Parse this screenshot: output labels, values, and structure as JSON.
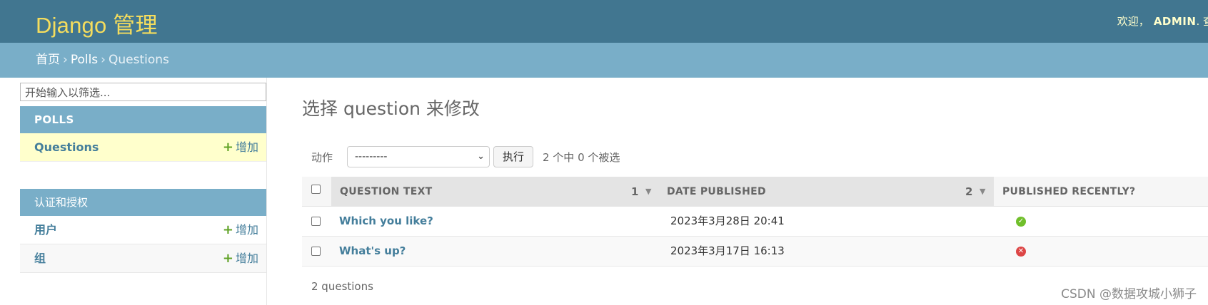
{
  "header": {
    "site_name": "Django 管理",
    "welcome": "欢迎，",
    "username": "ADMIN",
    "truncated_link": "查"
  },
  "breadcrumbs": {
    "home": "首页",
    "app": "Polls",
    "current": "Questions",
    "separator": "›"
  },
  "sidebar": {
    "filter_placeholder": "开始输入以筛选...",
    "modules": [
      {
        "caption": "POLLS",
        "models": [
          {
            "name": "Questions",
            "add_label": "增加"
          }
        ]
      },
      {
        "caption": "认证和授权",
        "models": [
          {
            "name": "用户",
            "add_label": "增加"
          },
          {
            "name": "组",
            "add_label": "增加"
          }
        ]
      }
    ]
  },
  "main": {
    "title": "选择 question 来修改",
    "actions": {
      "label": "动作",
      "selected_option": "---------",
      "go_label": "执行",
      "counter": "2 个中 0 个被选"
    },
    "table": {
      "columns": [
        {
          "label": "QUESTION TEXT",
          "sort_priority": "1"
        },
        {
          "label": "DATE PUBLISHED",
          "sort_priority": "2"
        },
        {
          "label": "PUBLISHED RECENTLY?",
          "sort_priority": ""
        }
      ],
      "rows": [
        {
          "question_text": "Which you like?",
          "date_published": "2023年3月28日 20:41",
          "published_recently": true,
          "status_icon": "yes-icon"
        },
        {
          "question_text": "What's up?",
          "date_published": "2023年3月17日 16:13",
          "published_recently": false,
          "status_icon": "no-icon"
        }
      ]
    },
    "paginator": "2 questions"
  },
  "watermark": "CSDN @数据攻城小狮子",
  "colors": {
    "header_bg": "#417690",
    "site_name": "#f5dd5d",
    "breadcrumb_bg": "#79aec8",
    "link": "#447e9b",
    "add_plus": "#5fa225",
    "selected_row_bg": "#ffffcc",
    "status_yes": "#70bf2b",
    "status_no": "#dd4646"
  }
}
